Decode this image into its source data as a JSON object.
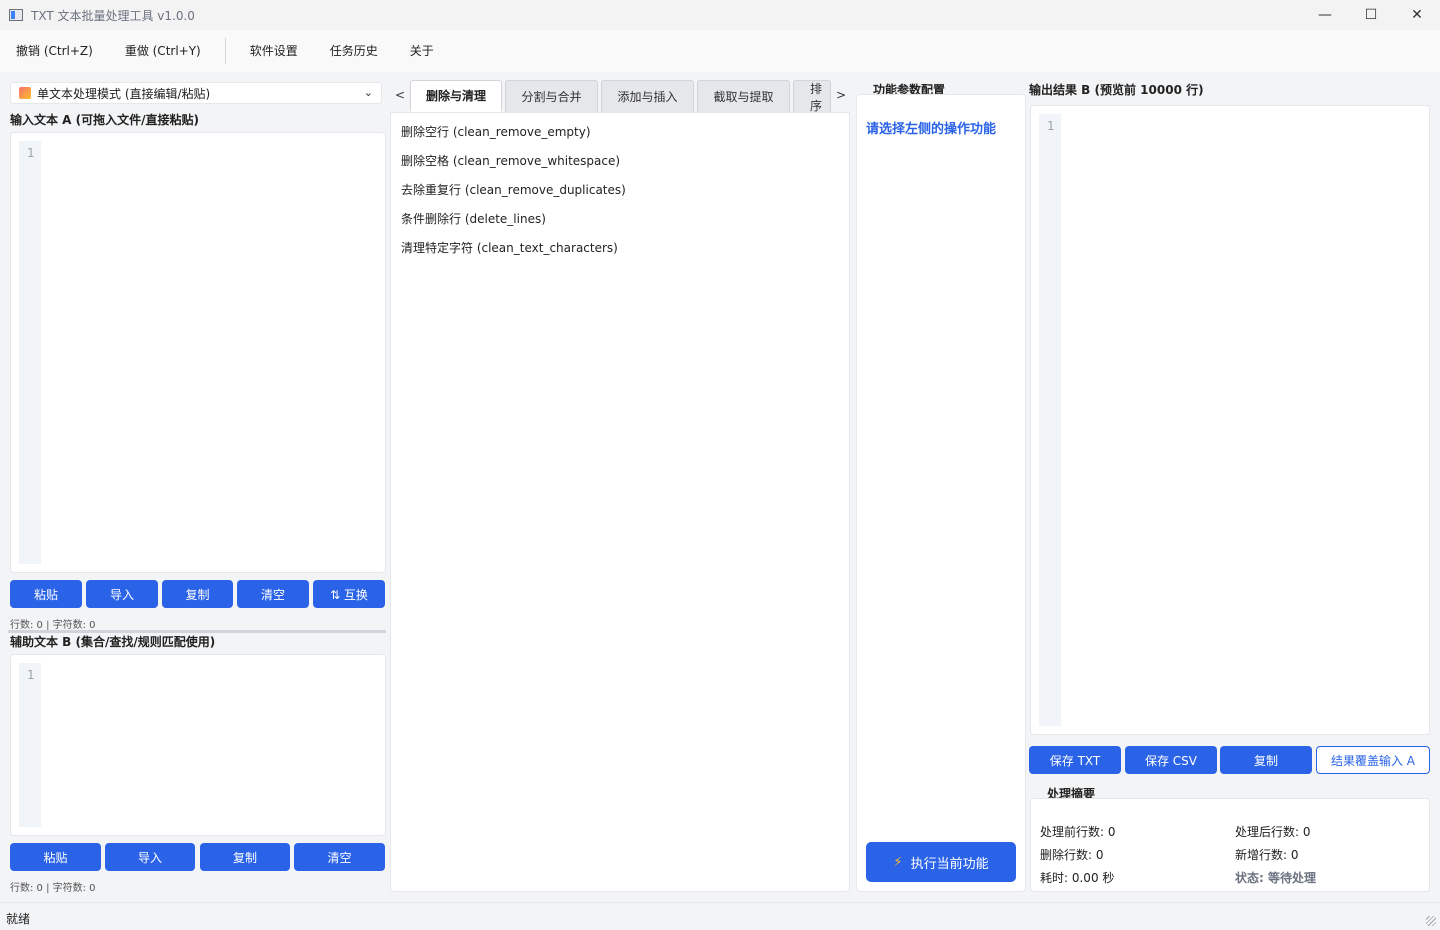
{
  "window": {
    "title": "TXT 文本批量处理工具 v1.0.0",
    "minimize": "—",
    "maximize": "☐",
    "close": "✕"
  },
  "menu": {
    "items": [
      "撤销 (Ctrl+Z)",
      "重做 (Ctrl+Y)",
      "软件设置",
      "任务历史",
      "关于"
    ]
  },
  "left": {
    "mode_select": "单文本处理模式 (直接编辑/粘贴)",
    "input_a_label": "输入文本 A (可拖入文件/直接粘贴)",
    "input_a_line": "1",
    "buttons_a": [
      "粘贴",
      "导入",
      "复制",
      "清空",
      "⇅ 互换"
    ],
    "stats_a": "行数: 0 | 字符数: 0",
    "input_b_label": "辅助文本 B (集合/查找/规则匹配使用)",
    "input_b_line": "1",
    "buttons_b": [
      "粘贴",
      "导入",
      "复制",
      "清空"
    ],
    "stats_b": "行数: 0 | 字符数: 0"
  },
  "middle": {
    "tab_prev": "<",
    "tab_next": ">",
    "tabs": [
      "删除与清理",
      "分割与合并",
      "添加与插入",
      "截取与提取",
      "排序"
    ],
    "active_tab": 0,
    "functions": [
      "删除空行 (clean_remove_empty)",
      "删除空格 (clean_remove_whitespace)",
      "去除重复行 (clean_remove_duplicates)",
      "条件删除行 (delete_lines)",
      "清理特定字符 (clean_text_characters)"
    ]
  },
  "params": {
    "label": "功能参数配置",
    "hint": "请选择左侧的操作功能",
    "execute_button": "执行当前功能"
  },
  "right": {
    "output_label": "输出结果 B (预览前 10000 行)",
    "output_line": "1",
    "buttons": [
      "保存 TXT",
      "保存 CSV",
      "复制",
      "结果覆盖输入 A"
    ],
    "summary_label": "处理摘要",
    "summary": {
      "before_lines": "处理前行数: 0",
      "after_lines": "处理后行数: 0",
      "deleted_lines": "删除行数: 0",
      "added_lines": "新增行数: 0",
      "elapsed": "耗时: 0.00 秒",
      "status": "状态: 等待处理"
    }
  },
  "statusbar": {
    "text": "就绪"
  },
  "colors": {
    "accent": "#2b63e8"
  }
}
